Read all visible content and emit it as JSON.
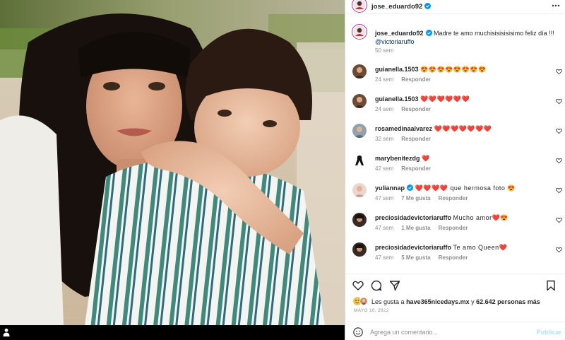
{
  "post": {
    "author": "jose_eduardo92",
    "caption_text": "Madre te amo muchisisisisisimo feliz día !!!",
    "caption_mention": "@victoriaruffo",
    "caption_time": "50 sem"
  },
  "comments": [
    {
      "user": "guianella.1503",
      "text": "😍😍😍😍😍😍😍😍",
      "time": "24 sem",
      "likes": "",
      "reply": "Responder"
    },
    {
      "user": "guianella.1503",
      "text": "❤️❤️❤️❤️❤️❤️",
      "time": "24 sem",
      "likes": "",
      "reply": "Responder"
    },
    {
      "user": "rosamedinaalvarez",
      "text": "❤️❤️❤️❤️❤️❤️❤️",
      "time": "32 sem",
      "likes": "",
      "reply": "Responder"
    },
    {
      "user": "marybenitezdg",
      "text": "❤️",
      "time": "42 sem",
      "likes": "",
      "reply": "Responder"
    },
    {
      "user": "yuliannap",
      "text": "❤️❤️❤️❤️ que hermosa foto 😍",
      "time": "47 sem",
      "likes": "7 Me gusta",
      "reply": "Responder"
    },
    {
      "user": "preciosidadevictoriaruffo",
      "text": "Mucho amor❤️😍",
      "time": "47 sem",
      "likes": "1 Me gusta",
      "reply": "Responder"
    },
    {
      "user": "preciosidadevictoriaruffo",
      "text": "Te amo Queen❤️",
      "time": "47 sem",
      "likes": "5 Me gusta",
      "reply": "Responder"
    }
  ],
  "likes": {
    "prefix": "Les gusta a",
    "user": "have365nicedays.mx",
    "joiner": "y",
    "count": "62.642 personas más"
  },
  "date": "MAYO 10, 2022",
  "add_comment": {
    "placeholder": "Agrega un comentario...",
    "post_label": "Publicar"
  },
  "colors": {
    "text": "#262626",
    "muted": "#8e8e8e",
    "verified": "#0095f6",
    "heart": "#ed4956",
    "post_disabled": "#b2dffc"
  },
  "icons": [
    "user-tag-icon",
    "verified-icon",
    "more-icon",
    "heart-icon",
    "comment-icon",
    "share-icon",
    "bookmark-icon",
    "emoji-icon"
  ]
}
